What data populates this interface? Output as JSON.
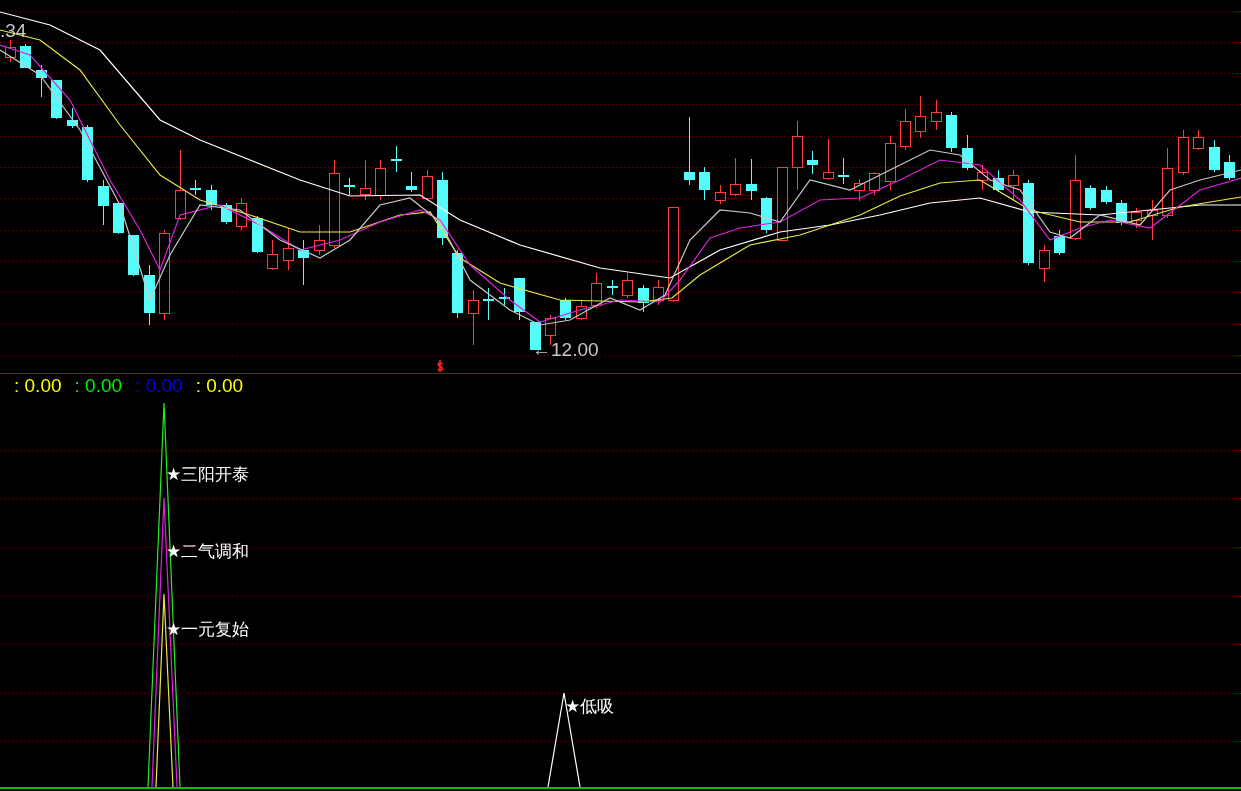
{
  "price_panel": {
    "high_label": ".34",
    "low_label": "←12.00"
  },
  "indicator_panel": {
    "legend": [
      {
        "text": ": 0.00",
        "color": "#ffff00"
      },
      {
        "text": ": 0.00",
        "color": "#00ee00"
      },
      {
        "text": ": 0.00",
        "color": "#0000ee"
      },
      {
        "text": ": 0.00",
        "color": "#ffff00"
      }
    ],
    "signals": [
      {
        "text": "★三阳开泰"
      },
      {
        "text": "★二气调和"
      },
      {
        "text": "★一元复始"
      },
      {
        "text": "★低吸"
      }
    ]
  }
}
